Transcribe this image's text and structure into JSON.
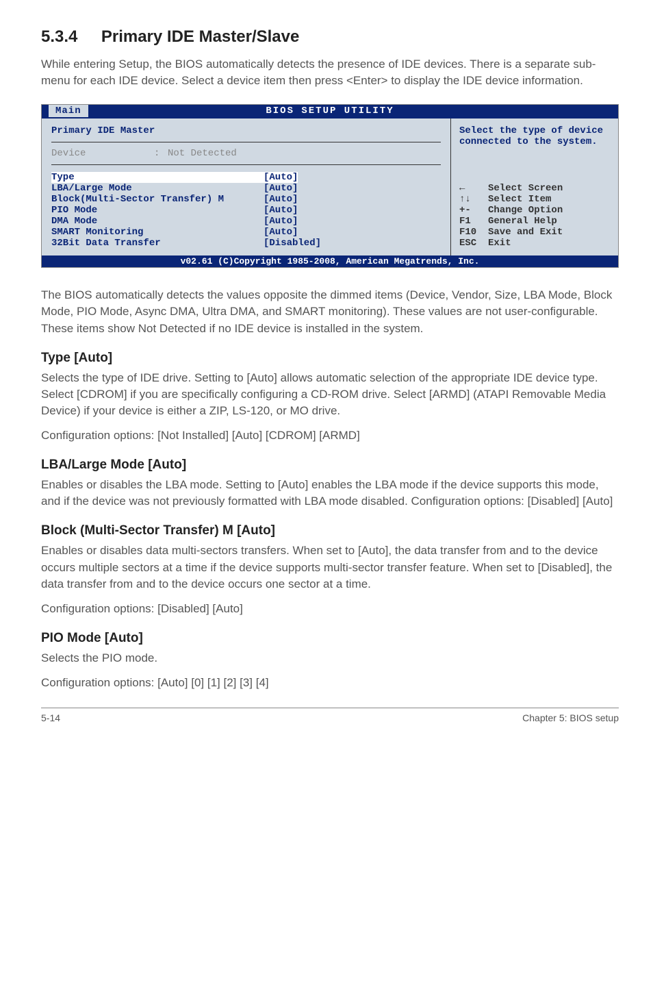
{
  "section": {
    "number": "5.3.4",
    "title": "Primary IDE Master/Slave",
    "intro": "While entering Setup, the BIOS automatically detects the presence of IDE devices. There is a separate sub-menu for each IDE device. Select a device item then press <Enter> to display the IDE device information."
  },
  "bios": {
    "titlebar": "BIOS SETUP UTILITY",
    "tab": "Main",
    "header": "Primary IDE Master",
    "device_label": "Device",
    "device_sep": ":",
    "device_value": "Not Detected",
    "rows": [
      {
        "label": "Type",
        "value": "[Auto]",
        "selected": true
      },
      {
        "label": "LBA/Large Mode",
        "value": "[Auto]"
      },
      {
        "label": "Block(Multi-Sector Transfer) M",
        "value": "[Auto]"
      },
      {
        "label": "PIO Mode",
        "value": "[Auto]"
      },
      {
        "label": "DMA Mode",
        "value": "[Auto]"
      },
      {
        "label": "SMART Monitoring",
        "value": "[Auto]"
      },
      {
        "label": "32Bit Data Transfer",
        "value": "[Disabled]"
      }
    ],
    "help_top": "Select the type of device connected to the system.",
    "help_keys": [
      {
        "key": "←",
        "desc": "Select Screen"
      },
      {
        "key": "↑↓",
        "desc": "Select Item"
      },
      {
        "key": "+-",
        "desc": "Change Option"
      },
      {
        "key": "F1",
        "desc": "General Help"
      },
      {
        "key": "F10",
        "desc": "Save and Exit"
      },
      {
        "key": "ESC",
        "desc": "Exit"
      }
    ],
    "footer": "v02.61 (C)Copyright 1985-2008, American Megatrends, Inc."
  },
  "after_bios": "The BIOS automatically detects the values opposite the dimmed items (Device, Vendor, Size, LBA Mode, Block Mode, PIO Mode, Async DMA, Ultra DMA, and SMART monitoring). These values are not user-configurable. These items show Not Detected if no IDE device is installed in the system.",
  "subsections": [
    {
      "heading": "Type [Auto]",
      "paragraphs": [
        "Selects the type of IDE drive. Setting to [Auto] allows automatic selection of the appropriate IDE device type. Select [CDROM] if you are specifically configuring a CD-ROM drive. Select [ARMD] (ATAPI Removable Media Device) if your device is either a ZIP, LS-120, or MO drive.",
        "Configuration options: [Not Installed] [Auto] [CDROM] [ARMD]"
      ]
    },
    {
      "heading": "LBA/Large Mode [Auto]",
      "paragraphs": [
        "Enables or disables the LBA mode. Setting to [Auto] enables the LBA mode if the device supports this mode, and if the device was not previously formatted with LBA mode disabled. Configuration options: [Disabled] [Auto]"
      ]
    },
    {
      "heading": "Block (Multi-Sector Transfer) M [Auto]",
      "paragraphs": [
        "Enables or disables data multi-sectors transfers. When set to [Auto], the data transfer from and to the device occurs multiple sectors at a time if the device supports multi-sector transfer feature. When set to [Disabled], the data transfer from and to the device occurs one sector at a time.",
        "Configuration options: [Disabled] [Auto]"
      ]
    },
    {
      "heading": "PIO Mode [Auto]",
      "paragraphs": [
        "Selects the PIO mode.",
        "Configuration options: [Auto] [0] [1] [2] [3] [4]"
      ]
    }
  ],
  "page_footer": {
    "left": "5-14",
    "right": "Chapter 5: BIOS setup"
  }
}
